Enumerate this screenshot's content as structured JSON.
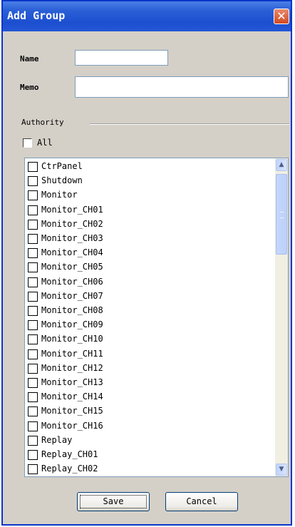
{
  "window": {
    "title": "Add Group",
    "close_symbol": "✕"
  },
  "form": {
    "name_label": "Name",
    "name_value": "",
    "memo_label": "Memo",
    "memo_value": ""
  },
  "authority": {
    "group_label": "Authority",
    "all_label": "All",
    "all_checked": false,
    "items": [
      "CtrPanel",
      "Shutdown",
      "Monitor",
      "Monitor_CH01",
      "Monitor_CH02",
      "Monitor_CH03",
      "Monitor_CH04",
      "Monitor_CH05",
      "Monitor_CH06",
      "Monitor_CH07",
      "Monitor_CH08",
      "Monitor_CH09",
      "Monitor_CH10",
      "Monitor_CH11",
      "Monitor_CH12",
      "Monitor_CH13",
      "Monitor_CH14",
      "Monitor_CH15",
      "Monitor_CH16",
      "Replay",
      "Replay_CH01",
      "Replay_CH02"
    ]
  },
  "buttons": {
    "save_label": "Save",
    "cancel_label": "Cancel"
  },
  "icons": {
    "scroll_up": "chevron-up-icon",
    "scroll_down": "chevron-down-icon",
    "close": "close-icon"
  },
  "colors": {
    "titlebar": "#1c4fd0",
    "dialog_bg": "#d4d0c8",
    "close_button": "#d14a22"
  }
}
